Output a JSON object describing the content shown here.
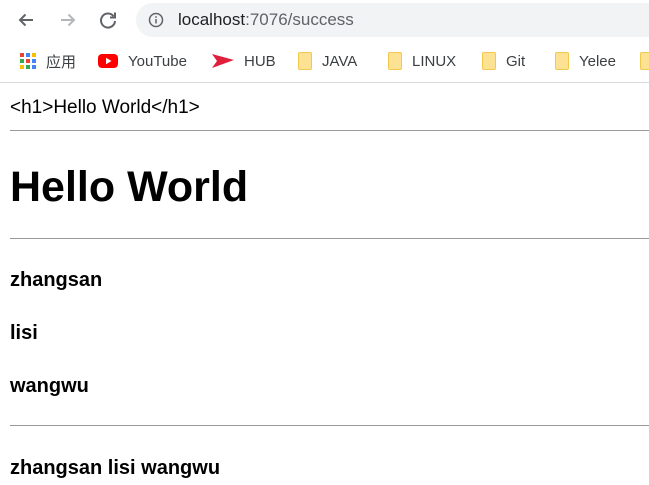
{
  "browser": {
    "url_host": "localhost",
    "url_rest": ":7076/success"
  },
  "bookmarks": [
    {
      "label": "应用",
      "icon": "apps-grid-icon"
    },
    {
      "label": "YouTube",
      "icon": "youtube-icon"
    },
    {
      "label": "HUB",
      "icon": "hub-icon"
    },
    {
      "label": "JAVA",
      "icon": "folder-icon"
    },
    {
      "label": "LINUX",
      "icon": "folder-icon"
    },
    {
      "label": "Git",
      "icon": "folder-icon"
    },
    {
      "label": "Yelee",
      "icon": "folder-icon"
    }
  ],
  "page": {
    "raw_html_text": "<h1>Hello World</h1>",
    "heading": "Hello World",
    "names": [
      "zhangsan",
      "lisi",
      "wangwu"
    ],
    "joined_names": "zhangsan lisi wangwu"
  },
  "colors": {
    "youtube_red": "#ff0000",
    "hub_red": "#e01f3d",
    "folder_yellow": "#fde293"
  }
}
